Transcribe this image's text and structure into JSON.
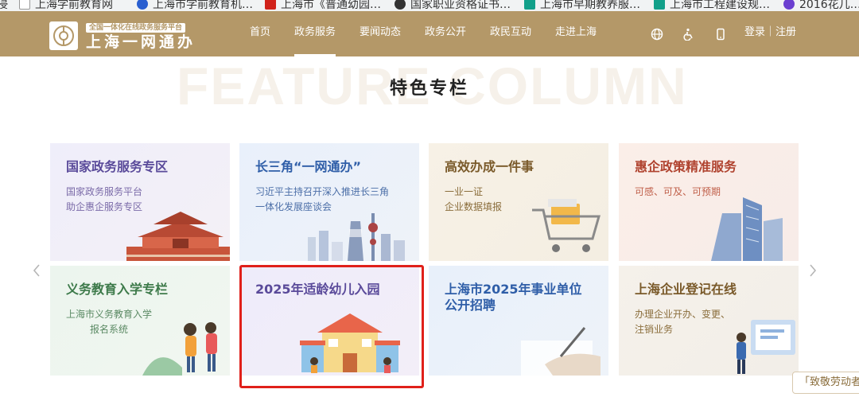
{
  "bookmarks": [
    {
      "label": "浸",
      "icon": "bookmark-icon"
    },
    {
      "label": "上海学前教育网",
      "icon": "page-icon"
    },
    {
      "label": "上海市学前教育机…",
      "icon": "blue-paw-icon"
    },
    {
      "label": "上海市《普通幼园…",
      "icon": "red-flag-icon"
    },
    {
      "label": "国家职业资格证书…",
      "icon": "globe-icon"
    },
    {
      "label": "上海市早期教养服…",
      "icon": "teal-doc-icon"
    },
    {
      "label": "上海市工程建设规…",
      "icon": "teal-doc-icon"
    },
    {
      "label": "2016花几…",
      "icon": "purple-paw-icon"
    }
  ],
  "header": {
    "logo_subtitle": "全国一体化在线政务服务平台",
    "logo_title": "上海一网通办",
    "nav": [
      "首页",
      "政务服务",
      "要闻动态",
      "政务公开",
      "政民互动",
      "走进上海"
    ],
    "active_nav": "政务服务",
    "login_label": "登录｜注册",
    "icons": [
      "globe-icon",
      "accessibility-icon",
      "mobile-icon"
    ]
  },
  "section": {
    "bg_title": "FEATURE COLUMN",
    "title": "特色专栏"
  },
  "cards": [
    {
      "title": "国家政务服务专区",
      "desc": [
        "国家政务服务平台",
        "助企惠企服务专区"
      ]
    },
    {
      "title": "长三角“一网通办”",
      "desc": [
        "习近平主持召开深入推进长三角",
        "一体化发展座谈会"
      ]
    },
    {
      "title": "高效办成一件事",
      "desc": [
        "一业一证",
        "企业数据填报"
      ]
    },
    {
      "title": "惠企政策精准服务",
      "desc": [
        "可感、可及、可预期"
      ]
    },
    {
      "title": "义务教育入学专栏",
      "desc": [
        "上海市义务教育入学",
        "报名系统"
      ]
    },
    {
      "title": "2025年适龄幼儿入园",
      "desc": []
    },
    {
      "title": "上海市2025年事业单位",
      "title2": "公开招聘",
      "desc": []
    },
    {
      "title": "上海企业登记在线",
      "desc": [
        "办理企业开办、变更、",
        "注销业务"
      ]
    }
  ],
  "float_tag": "「致敬劳动者」",
  "colors": {
    "header_bg": "#b49868",
    "highlight": "#e0201a",
    "purple_title": "#5a4a9a",
    "blue_title": "#2f5ea8",
    "brown_title": "#7a5a2a",
    "red_title": "#b0432f",
    "green_title": "#3d7a4a"
  }
}
